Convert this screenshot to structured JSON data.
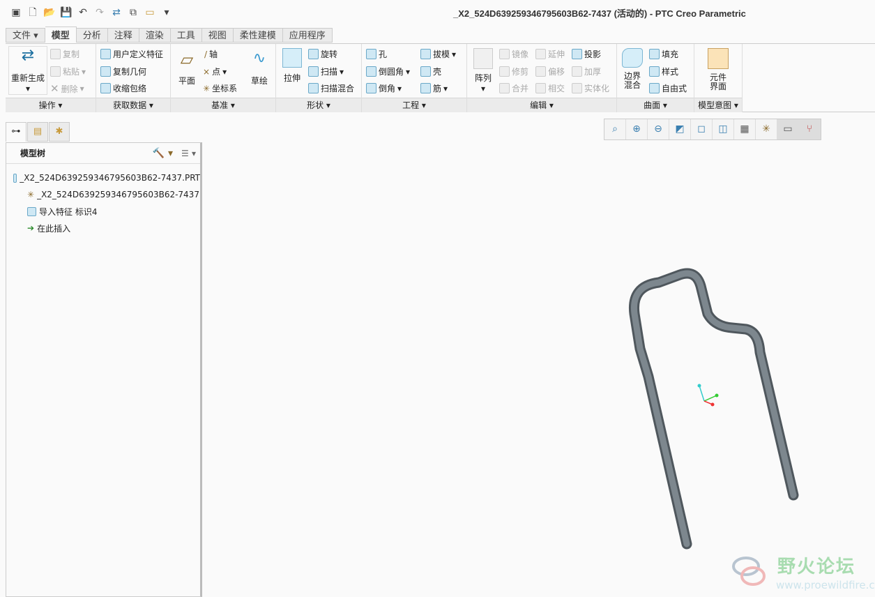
{
  "window": {
    "title": "_X2_524D639259346795603B62-7437 (活动的) - PTC Creo Parametric"
  },
  "quick_access": [
    "window-icon",
    "new-icon",
    "open-icon",
    "save-icon",
    "undo-icon",
    "redo-icon",
    "regenerate-icon",
    "windows-icon",
    "close-icon",
    "customize-icon"
  ],
  "tabs": [
    "文件",
    "模型",
    "分析",
    "注释",
    "渲染",
    "工具",
    "视图",
    "柔性建模",
    "应用程序"
  ],
  "active_tab": "模型",
  "ribbon": {
    "ops": {
      "label": "操作",
      "regen": "重新生成",
      "copy": "复制",
      "paste": "粘贴",
      "delete": "删除"
    },
    "get": {
      "label": "获取数据",
      "udf": "用户定义特征",
      "copygeom": "复制几何",
      "shrink": "收缩包络"
    },
    "datum": {
      "label": "基准",
      "plane": "平面",
      "axis": "轴",
      "point": "点",
      "csys": "坐标系",
      "sketch": "草绘"
    },
    "shape": {
      "label": "形状",
      "extrude": "拉伸",
      "revolve": "旋转",
      "sweep": "扫描",
      "swblend": "扫描混合"
    },
    "eng": {
      "label": "工程",
      "hole": "孔",
      "round": "倒圆角",
      "chamfer": "倒角",
      "draft": "拔模",
      "shell": "壳",
      "rib": "筋"
    },
    "edit": {
      "label": "编辑",
      "pattern": "阵列",
      "mirror": "镜像",
      "trim": "修剪",
      "merge": "合并",
      "extend": "延伸",
      "offset": "偏移",
      "intersect": "相交",
      "project": "投影",
      "thicken": "加厚",
      "solidify": "实体化"
    },
    "surf": {
      "label": "曲面",
      "boundary": "边界混合",
      "fill": "填充",
      "style": "样式",
      "freestyle": "自由式"
    },
    "intent": {
      "label": "模型意图",
      "comp": "元件界面"
    }
  },
  "model_tree": {
    "title": "模型树",
    "items": [
      "_X2_524D639259346795603B62-7437.PRT",
      "_X2_524D639259346795603B62-7437",
      "导入特征 标识4",
      "在此插入"
    ]
  },
  "view_toolbar": [
    "refit-icon",
    "zoom-in-icon",
    "zoom-out-icon",
    "repaint-icon",
    "saved-orientations-icon",
    "saved-views-icon",
    "display-style-icon",
    "datum-display-icon",
    "annotation-display-icon",
    "spin-center-icon"
  ],
  "watermark": {
    "name": "野火论坛",
    "url": "www.proewildfire.cn"
  },
  "colors": {
    "model": "#6b747b",
    "accent": "#3a7fb0"
  }
}
